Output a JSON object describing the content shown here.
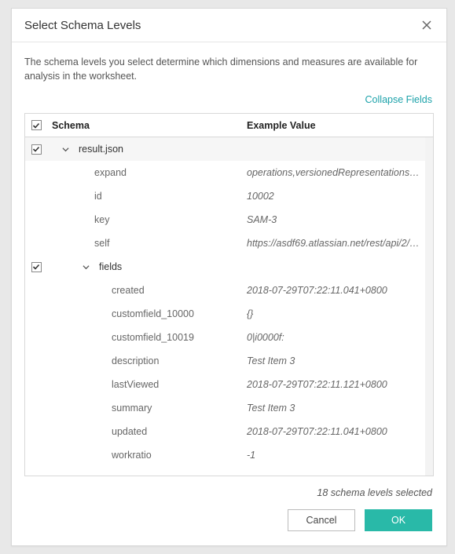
{
  "dialog": {
    "title": "Select Schema Levels",
    "intro": "The schema levels you select determine which dimensions and measures are available for analysis in the worksheet.",
    "collapse_link": "Collapse Fields",
    "status": "18 schema levels selected",
    "cancel_label": "Cancel",
    "ok_label": "OK"
  },
  "table": {
    "header_schema": "Schema",
    "header_example": "Example Value",
    "groups": [
      {
        "name": "result.json",
        "checked": true,
        "rows": [
          {
            "field": "expand",
            "example": "operations,versionedRepresentations,edit…"
          },
          {
            "field": "id",
            "example": "10002"
          },
          {
            "field": "key",
            "example": "SAM-3"
          },
          {
            "field": "self",
            "example": "https://asdf69.atlassian.net/rest/api/2/…"
          }
        ]
      },
      {
        "name": "fields",
        "checked": true,
        "rows": [
          {
            "field": "created",
            "example": "2018-07-29T07:22:11.041+0800"
          },
          {
            "field": "customfield_10000",
            "example": "{}"
          },
          {
            "field": "customfield_10019",
            "example": "0|i0000f:"
          },
          {
            "field": "description",
            "example": "Test Item 3"
          },
          {
            "field": "lastViewed",
            "example": "2018-07-29T07:22:11.121+0800"
          },
          {
            "field": "summary",
            "example": "Test Item 3"
          },
          {
            "field": "updated",
            "example": "2018-07-29T07:22:11.041+0800"
          },
          {
            "field": "workratio",
            "example": "-1"
          }
        ]
      }
    ]
  }
}
